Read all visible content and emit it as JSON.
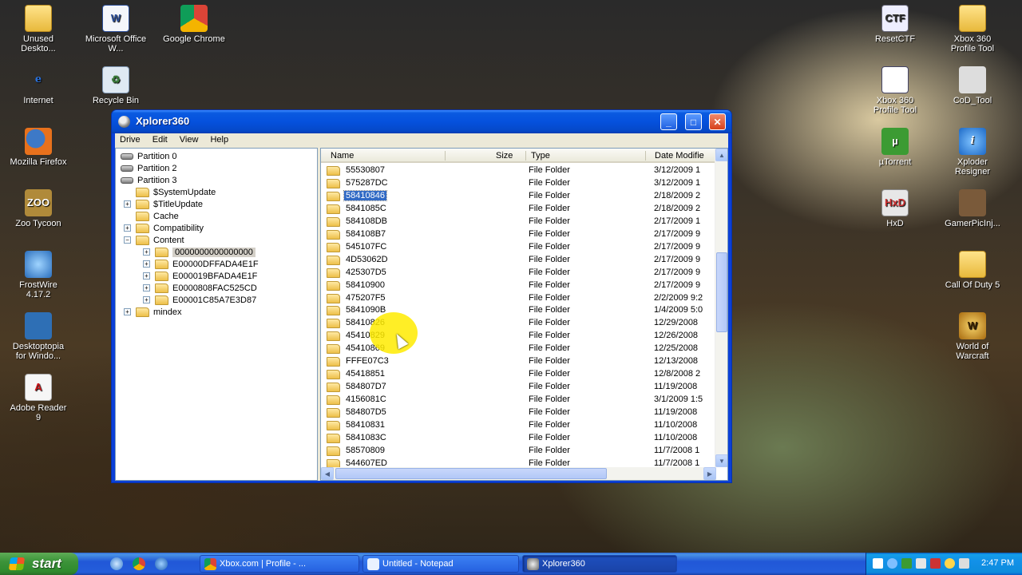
{
  "desktop": {
    "left_icons": [
      {
        "label": "Unused Deskto...",
        "icon": "folder-icon"
      },
      {
        "label": "Microsoft Office W...",
        "icon": "word-document-icon"
      },
      {
        "label": "Google Chrome",
        "icon": "chrome-icon"
      },
      {
        "label": "Internet",
        "icon": "internet-explorer-icon"
      },
      {
        "label": "Recycle Bin",
        "icon": "recycle-bin-icon"
      },
      {
        "label": "Mozilla Firefox",
        "icon": "firefox-icon"
      },
      {
        "label": "Zoo Tycoon",
        "icon": "zoo-tycoon-icon"
      },
      {
        "label": "FrostWire 4.17.2",
        "icon": "frostwire-icon"
      },
      {
        "label": "Desktoptopia for Windo...",
        "icon": "desktoptopia-icon"
      },
      {
        "label": "Adobe Reader 9",
        "icon": "adobe-reader-icon"
      }
    ],
    "right_icons": [
      {
        "label": "ResetCTF",
        "icon": "resetctf-icon"
      },
      {
        "label": "Xbox 360 Profile Tool",
        "icon": "folder-icon"
      },
      {
        "label": "Xbox 360 Profile Tool",
        "icon": "application-window-icon"
      },
      {
        "label": "CoD_Tool",
        "icon": "cod-tool-icon"
      },
      {
        "label": "µTorrent",
        "icon": "utorrent-icon"
      },
      {
        "label": "Xploder Resigner",
        "icon": "xploder-icon"
      },
      {
        "label": "HxD",
        "icon": "hxd-icon"
      },
      {
        "label": "GamerPicInj...",
        "icon": "gamerpic-icon"
      },
      {
        "label": "Call Of Duty 5",
        "icon": "folder-icon"
      },
      {
        "label": "World of Warcraft",
        "icon": "world-of-warcraft-icon"
      }
    ]
  },
  "window": {
    "title": "Xplorer360",
    "menu": [
      "Drive",
      "Edit",
      "View",
      "Help"
    ],
    "controls": {
      "minimize": "_",
      "maximize": "□",
      "close": "✕"
    }
  },
  "tree": [
    {
      "label": "Partition 0",
      "type": "drive",
      "level": 0,
      "expander": ""
    },
    {
      "label": "Partition 2",
      "type": "drive",
      "level": 0,
      "expander": ""
    },
    {
      "label": "Partition 3",
      "type": "drive",
      "level": 0,
      "expander": ""
    },
    {
      "label": "$SystemUpdate",
      "type": "folder",
      "level": 1,
      "expander": ""
    },
    {
      "label": "$TitleUpdate",
      "type": "folder",
      "level": 1,
      "expander": "+"
    },
    {
      "label": "Cache",
      "type": "folder",
      "level": 1,
      "expander": ""
    },
    {
      "label": "Compatibility",
      "type": "folder",
      "level": 1,
      "expander": "+"
    },
    {
      "label": "Content",
      "type": "folder",
      "level": 1,
      "expander": "−"
    },
    {
      "label": "0000000000000000",
      "type": "folder",
      "level": 2,
      "expander": "+",
      "selected": true
    },
    {
      "label": "E00000DFFADA4E1F",
      "type": "folder",
      "level": 2,
      "expander": "+"
    },
    {
      "label": "E000019BFADA4E1F",
      "type": "folder",
      "level": 2,
      "expander": "+"
    },
    {
      "label": "E0000808FAC525CD",
      "type": "folder",
      "level": 2,
      "expander": "+"
    },
    {
      "label": "E00001C85A7E3D87",
      "type": "folder",
      "level": 2,
      "expander": "+"
    },
    {
      "label": "mindex",
      "type": "folder",
      "level": 1,
      "expander": "+"
    }
  ],
  "list": {
    "columns": {
      "name": "Name",
      "size": "Size",
      "type": "Type",
      "date": "Date Modifie"
    },
    "rows": [
      {
        "name": "55530807",
        "type": "File Folder",
        "date": "3/12/2009 1"
      },
      {
        "name": "575287DC",
        "type": "File Folder",
        "date": "3/12/2009 1"
      },
      {
        "name": "58410846",
        "type": "File Folder",
        "date": "2/18/2009 2",
        "selected": true
      },
      {
        "name": "5841085C",
        "type": "File Folder",
        "date": "2/18/2009 2"
      },
      {
        "name": "584108DB",
        "type": "File Folder",
        "date": "2/17/2009 1"
      },
      {
        "name": "584108B7",
        "type": "File Folder",
        "date": "2/17/2009 9"
      },
      {
        "name": "545107FC",
        "type": "File Folder",
        "date": "2/17/2009 9"
      },
      {
        "name": "4D53062D",
        "type": "File Folder",
        "date": "2/17/2009 9"
      },
      {
        "name": "425307D5",
        "type": "File Folder",
        "date": "2/17/2009 9"
      },
      {
        "name": "58410900",
        "type": "File Folder",
        "date": "2/17/2009 9"
      },
      {
        "name": "475207F5",
        "type": "File Folder",
        "date": "2/2/2009 9:2"
      },
      {
        "name": "5841090B",
        "type": "File Folder",
        "date": "1/4/2009 5:0"
      },
      {
        "name": "58410826",
        "type": "File Folder",
        "date": "12/29/2008"
      },
      {
        "name": "45410829",
        "type": "File Folder",
        "date": "12/26/2008"
      },
      {
        "name": "45410869",
        "type": "File Folder",
        "date": "12/25/2008"
      },
      {
        "name": "FFFE07C3",
        "type": "File Folder",
        "date": "12/13/2008"
      },
      {
        "name": "45418851",
        "type": "File Folder",
        "date": "12/8/2008 2"
      },
      {
        "name": "584807D7",
        "type": "File Folder",
        "date": "11/19/2008"
      },
      {
        "name": "4156081C",
        "type": "File Folder",
        "date": "3/1/2009 1:5"
      },
      {
        "name": "584807D5",
        "type": "File Folder",
        "date": "11/19/2008"
      },
      {
        "name": "58410831",
        "type": "File Folder",
        "date": "11/10/2008"
      },
      {
        "name": "5841083C",
        "type": "File Folder",
        "date": "11/10/2008"
      },
      {
        "name": "58570809",
        "type": "File Folder",
        "date": "11/7/2008 1"
      },
      {
        "name": "544607ED",
        "type": "File Folder",
        "date": "11/7/2008 1"
      }
    ]
  },
  "taskbar": {
    "start_label": "start",
    "tasks": [
      {
        "label": "Xbox.com | Profile - ...",
        "icon": "chrome-icon"
      },
      {
        "label": "Untitled - Notepad",
        "icon": "notepad-icon"
      },
      {
        "label": "Xplorer360",
        "icon": "xplorer360-icon",
        "active": true
      }
    ],
    "clock": "2:47 PM"
  }
}
